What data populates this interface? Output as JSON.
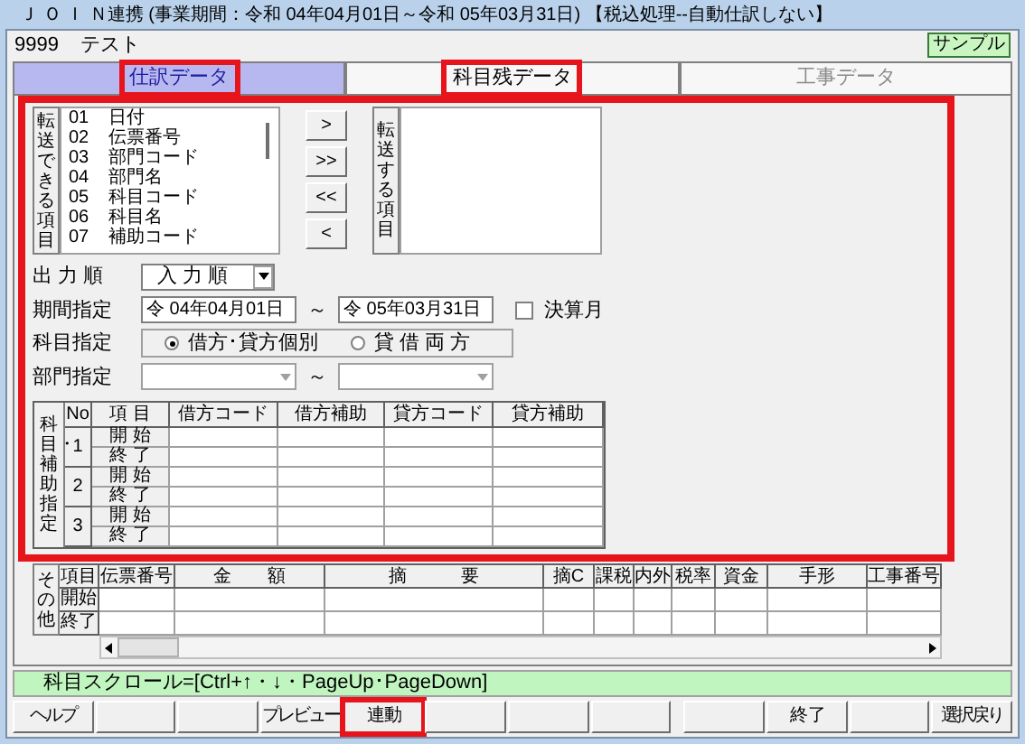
{
  "window": {
    "title": "Ｊ Ｏ Ｉ Ｎ連携 (事業期間：令和 04年04月01日～令和 05年03月31日) 【税込処理--自動仕訳しない】"
  },
  "company": {
    "code": "9999",
    "name": "テスト"
  },
  "badge": "サンプル",
  "tabs": [
    {
      "label": "仕訳データ",
      "selected": true,
      "highlighted": true,
      "disabled": false
    },
    {
      "label": "科目残データ",
      "selected": false,
      "highlighted": true,
      "disabled": false
    },
    {
      "label": "工事データ",
      "selected": false,
      "highlighted": false,
      "disabled": true
    }
  ],
  "form": {
    "highlighted": true
  },
  "transfer": {
    "available_label": "転送できる項目",
    "available_items": [
      {
        "code": "01",
        "name": "日付"
      },
      {
        "code": "02",
        "name": "伝票番号"
      },
      {
        "code": "03",
        "name": "部門コード"
      },
      {
        "code": "04",
        "name": "部門名"
      },
      {
        "code": "05",
        "name": "科目コード"
      },
      {
        "code": "06",
        "name": "科目名"
      },
      {
        "code": "07",
        "name": "補助コード"
      }
    ],
    "move_buttons": [
      ">",
      ">>",
      "<<",
      "<"
    ],
    "selected_label": "転送する項目"
  },
  "output_order": {
    "label": "出 力 順",
    "value": "入 力 順"
  },
  "period": {
    "label": "期間指定",
    "from": "令 04年04月01日",
    "separator": "～",
    "to": "令 05年03月31日",
    "closing_month": {
      "label": "決算月",
      "checked": false
    }
  },
  "account": {
    "label": "科目指定",
    "options": [
      {
        "label": "借方･貸方個別",
        "selected": true
      },
      {
        "label": "貸 借 両 方",
        "selected": false
      }
    ]
  },
  "department": {
    "label": "部門指定",
    "separator": "～"
  },
  "account_table": {
    "side_label": "科目・補助指定",
    "columns": [
      "No",
      "項 目",
      "借方コード",
      "借方補助",
      "貸方コード",
      "貸方補助"
    ],
    "rows": [
      {
        "no": "1",
        "items": [
          "開 始",
          "終 了"
        ]
      },
      {
        "no": "2",
        "items": [
          "開 始",
          "終 了"
        ]
      },
      {
        "no": "3",
        "items": [
          "開 始",
          "終 了"
        ]
      }
    ]
  },
  "other_table": {
    "side_label": "その他",
    "columns": [
      "項目",
      "伝票番号",
      "金　　額",
      "摘　　　要",
      "摘C",
      "課税",
      "内外",
      "税率",
      "資金",
      "手形",
      "工事番号"
    ],
    "rows": [
      "開始",
      "終了"
    ]
  },
  "status": "科目スクロール=[Ctrl+↑・↓・PageUp･PageDown]",
  "buttons": {
    "left": [
      {
        "kind": "label",
        "label": "ヘルプ",
        "highlighted": false
      },
      {
        "kind": "blank",
        "highlighted": false
      },
      {
        "kind": "blank",
        "highlighted": false
      },
      {
        "kind": "label",
        "label": "プレビュー",
        "highlighted": false
      },
      {
        "kind": "label",
        "label": "連 動",
        "highlighted": true
      },
      {
        "kind": "blank",
        "highlighted": false
      },
      {
        "kind": "blank",
        "highlighted": false
      },
      {
        "kind": "blank",
        "highlighted": false
      }
    ],
    "right": [
      {
        "kind": "blank",
        "highlighted": false
      },
      {
        "kind": "label",
        "label": "終 了",
        "highlighted": false
      },
      {
        "kind": "blank",
        "highlighted": false
      },
      {
        "kind": "label",
        "label": "選択戻り",
        "highlighted": false
      }
    ]
  }
}
